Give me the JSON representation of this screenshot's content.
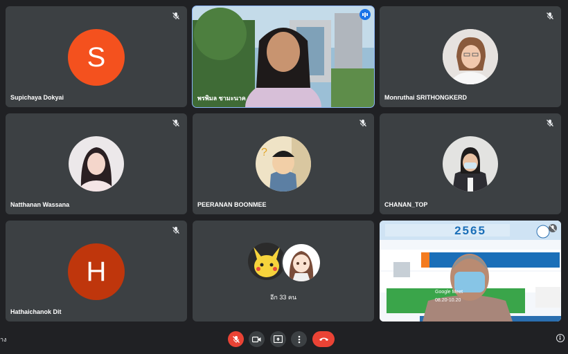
{
  "participants": [
    {
      "name": "Supichaya Dokyai",
      "initial": "S",
      "color": "#f4511e"
    },
    {
      "name": "พรพิมล ชามะนาค"
    },
    {
      "name": "Monruthai SRITHONGKERD"
    },
    {
      "name": "Natthanan Wassana"
    },
    {
      "name": "PEERANAN BOONMEE"
    },
    {
      "name": "CHANAN_TOP"
    },
    {
      "name": "Hathaichanok Dit",
      "initial": "H",
      "color": "#bf360c"
    }
  ],
  "others_tile": {
    "label": "อีก 33 คน"
  },
  "banner": {
    "year": "2565",
    "google_meet": "Google Meet",
    "time": "08.20-10.20"
  },
  "bottom_bar": {
    "left_text": "าง",
    "mic_color": "#ea4335",
    "end_call_color": "#ea4335"
  }
}
